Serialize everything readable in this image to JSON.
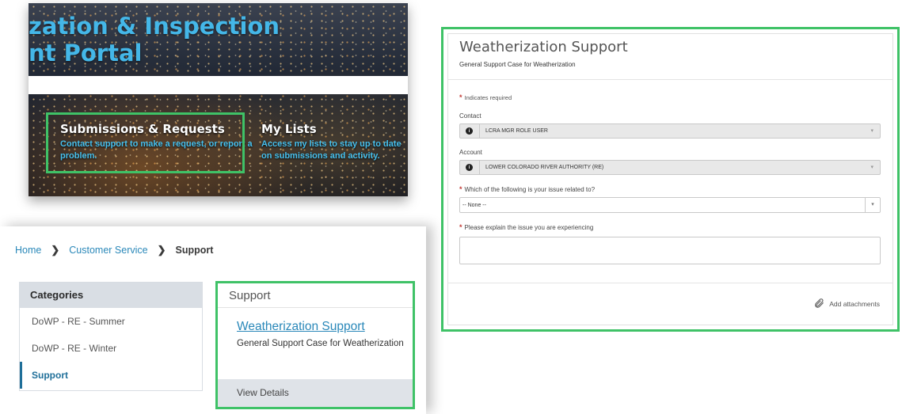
{
  "hero": {
    "title_line1": "zation & Inspection",
    "title_line2": "nt Portal",
    "cards": [
      {
        "title": "Submissions & Requests",
        "desc": "Contact support to make a request, or report a problem."
      },
      {
        "title": "My Lists",
        "desc": "Access my lists to stay up to date on submissions and activity."
      }
    ]
  },
  "breadcrumb": {
    "home": "Home",
    "customer_service": "Customer Service",
    "current": "Support",
    "separator": "❯"
  },
  "categories": {
    "header": "Categories",
    "items": [
      {
        "label": "DoWP - RE - Summer"
      },
      {
        "label": "DoWP - RE - Winter"
      },
      {
        "label": "Support"
      }
    ],
    "active": "Support"
  },
  "support_card": {
    "header": "Support",
    "link": "Weatherization Support",
    "desc": "General Support Case for Weatherization",
    "footer": "View Details"
  },
  "form": {
    "title": "Weatherization Support",
    "subtitle": "General Support Case for Weatherization",
    "required_note": "Indicates required",
    "contact_label": "Contact",
    "contact_value": "LCRA MGR ROLE USER",
    "account_label": "Account",
    "account_value": "LOWER COLORADO RIVER AUTHORITY (RE)",
    "issue_label": "Which of the following is your issue related to?",
    "issue_value": "-- None --",
    "explain_label": "Please explain the issue you are experiencing",
    "explain_value": "",
    "attach_label": "Add attachments"
  },
  "colors": {
    "highlight": "#3fc267",
    "link": "#2a88b9",
    "hero_title": "#44b7e8",
    "required": "#c23934"
  },
  "icons": {
    "info": "info-icon",
    "attachment": "paperclip-icon",
    "breadcrumb_separator": "chevron-right-icon"
  }
}
